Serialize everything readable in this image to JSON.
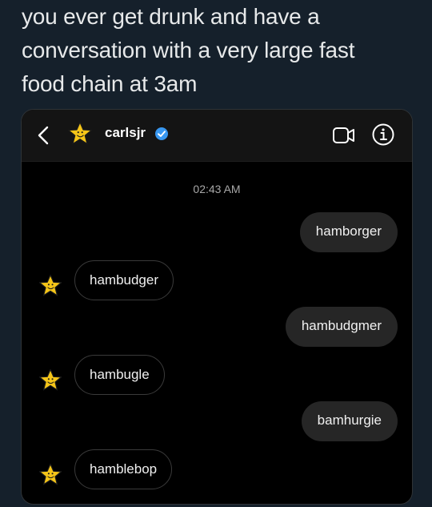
{
  "post": {
    "text": "you ever get drunk and have a\nconversation with a very large fast\nfood chain at 3am"
  },
  "chat": {
    "username": "carlsjr",
    "timestamp": "02:43 AM",
    "icons": [
      "back-arrow-icon",
      "carlsjr-star-logo",
      "verified-badge-icon",
      "video-call-icon",
      "info-icon"
    ],
    "messages": [
      {
        "from": "me",
        "text": "hamborger"
      },
      {
        "from": "carlsjr",
        "text": "hambudger"
      },
      {
        "from": "me",
        "text": "hambudgmer"
      },
      {
        "from": "carlsjr",
        "text": "hambugle"
      },
      {
        "from": "me",
        "text": "bamhurgie"
      },
      {
        "from": "carlsjr",
        "text": "hamblebop"
      }
    ]
  },
  "colors": {
    "page_background": "#15202b",
    "card_background": "#000000",
    "outgoing_bubble": "#262626",
    "verified_blue": "#3897f0",
    "star_yellow": "#f5c518"
  }
}
